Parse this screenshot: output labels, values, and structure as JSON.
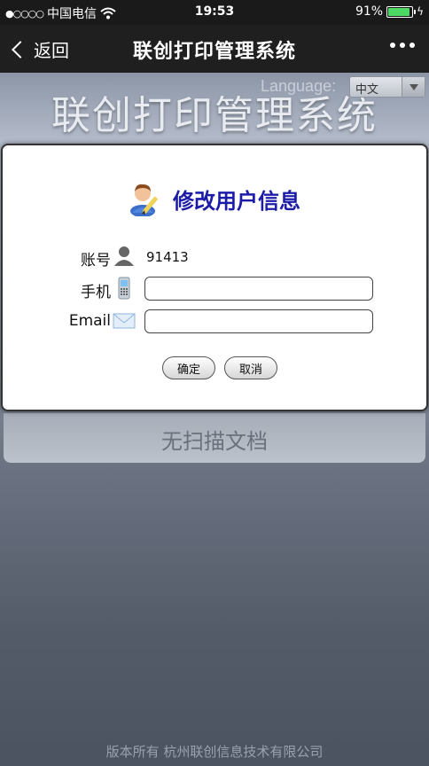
{
  "status_bar": {
    "signal": "●○○○○",
    "carrier": "中国电信",
    "time": "19:53",
    "battery_percent": "91%",
    "battery_level": 0.91
  },
  "nav": {
    "back_label": "返回",
    "title": "联创打印管理系统"
  },
  "page": {
    "language_label": "Language:",
    "language_value": "中文",
    "heading": "联创打印管理系统",
    "no_docs": "无扫描文档",
    "footer": "版本所有 杭州联创信息技术有限公司"
  },
  "modal": {
    "title": "修改用户信息",
    "account_label": "账号",
    "account_value": "91413",
    "phone_label": "手机",
    "phone_value": "",
    "email_label": "Email",
    "email_value": "",
    "confirm_label": "确定",
    "cancel_label": "取消"
  },
  "colors": {
    "title_blue": "#1c1ca8",
    "battery_green": "#4cd964"
  }
}
